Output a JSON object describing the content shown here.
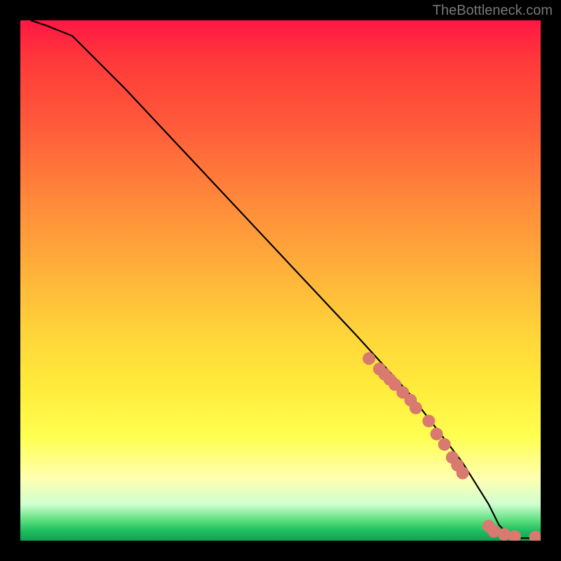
{
  "attribution": "TheBottleneck.com",
  "chart_data": {
    "type": "line",
    "title": "",
    "xlabel": "",
    "ylabel": "",
    "xlim": [
      0,
      100
    ],
    "ylim": [
      0,
      100
    ],
    "series": [
      {
        "name": "curve",
        "x": [
          2,
          5,
          10,
          20,
          35,
          50,
          65,
          75,
          85,
          90,
          92,
          94,
          96,
          98,
          100
        ],
        "y": [
          100,
          99,
          97,
          87,
          71,
          55,
          39,
          28,
          15,
          7,
          3,
          1,
          0.5,
          0.5,
          0.5
        ]
      }
    ],
    "markers": {
      "name": "highlighted-points",
      "color": "#d87a6f",
      "x": [
        67,
        69,
        70,
        71,
        72,
        73.5,
        75,
        76,
        78.5,
        80,
        81.5,
        83,
        84,
        85,
        90,
        91,
        93,
        95,
        99
      ],
      "y": [
        35,
        33,
        32,
        31,
        30,
        28.5,
        27,
        25.5,
        23,
        20.5,
        18.5,
        16,
        14.5,
        13,
        2.8,
        1.8,
        1.2,
        0.8,
        0.7
      ]
    }
  }
}
